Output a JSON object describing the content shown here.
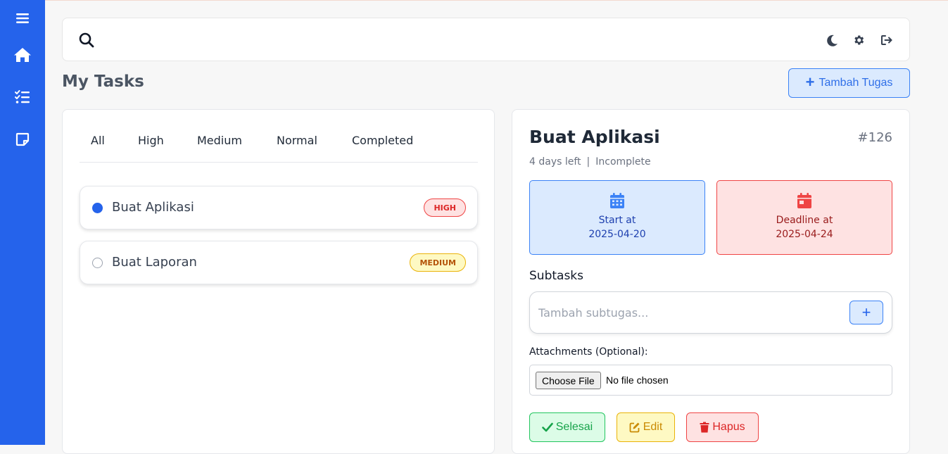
{
  "sidebar": {
    "items": [
      {
        "icon": "menu-icon"
      },
      {
        "icon": "home-icon"
      },
      {
        "icon": "task-list-icon"
      },
      {
        "icon": "note-icon"
      }
    ],
    "color": "#2563eb"
  },
  "header": {
    "search_icon": "search-icon",
    "icons": [
      "moon-icon",
      "gear-icon",
      "logout-icon"
    ]
  },
  "page": {
    "title": "My Tasks",
    "add_task_label": "Tambah Tugas"
  },
  "filters": {
    "tabs": [
      "All",
      "High",
      "Medium",
      "Normal",
      "Completed"
    ]
  },
  "tasks": [
    {
      "title": "Buat Aplikasi",
      "priority": "HIGH",
      "selected": true
    },
    {
      "title": "Buat Laporan",
      "priority": "MEDIUM",
      "selected": false
    }
  ],
  "detail": {
    "title": "Buat Aplikasi",
    "id": "#126",
    "days_left": "4 days left",
    "status": "Incomplete",
    "start_label": "Start at",
    "start_date": "2025-04-20",
    "deadline_label": "Deadline at",
    "deadline_date": "2025-04-24",
    "subtasks_label": "Subtasks",
    "subtask_placeholder": "Tambah subtugas...",
    "attachments_label": "Attachments (Optional):",
    "file_button": "Choose File",
    "file_status": "No file chosen",
    "actions": {
      "done": "Selesai",
      "edit": "Edit",
      "delete": "Hapus"
    }
  },
  "colors": {
    "accent": "#2563eb",
    "high": "#ef4444",
    "medium": "#eab308",
    "success": "#22c55e"
  }
}
